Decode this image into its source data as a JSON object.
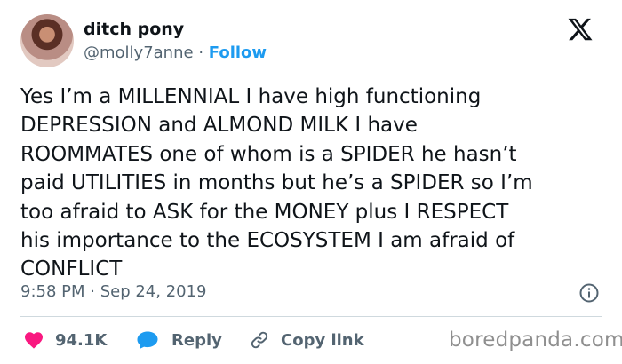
{
  "author": {
    "display_name": "ditch pony",
    "handle": "@molly7anne",
    "separator": "·",
    "follow_label": "Follow"
  },
  "tweet": {
    "lines": [
      "Yes I’m a MILLENNIAL I have high functioning",
      "DEPRESSION and ALMOND MILK I have",
      "ROOMMATES one of whom is a SPIDER he hasn’t",
      "paid UTILITIES in months but he’s a SPIDER so I’m",
      "too afraid to ASK for the MONEY plus I RESPECT",
      "his importance to the ECOSYSTEM I am afraid of",
      "CONFLICT"
    ],
    "timestamp": "9:58 PM · Sep 24, 2019"
  },
  "actions": {
    "likes": "94.1K",
    "reply_label": "Reply",
    "copy_link_label": "Copy link"
  },
  "icons": {
    "brand": "x-logo-icon",
    "info": "info-icon",
    "like": "heart-icon",
    "reply": "speech-bubble-icon",
    "copy": "link-icon"
  },
  "colors": {
    "accent": "#1d9bf0",
    "like": "#f91880",
    "muted_text": "#536471",
    "text": "#0f1419"
  },
  "watermark": "boredpanda.com"
}
